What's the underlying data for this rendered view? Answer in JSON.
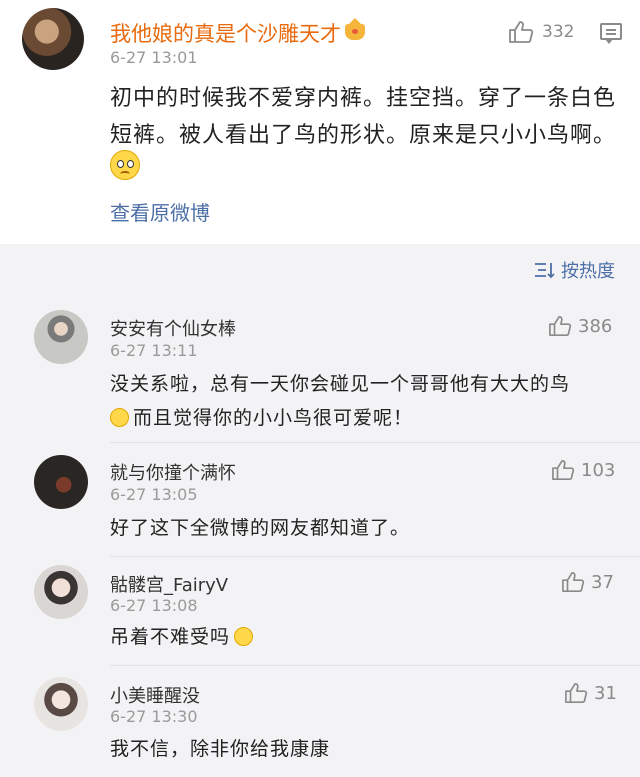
{
  "post": {
    "username": "我他娘的真是个沙雕天才",
    "time": "6-27 13:01",
    "likes": "332",
    "text": "初中的时候我不爱穿内裤。挂空挡。穿了一条白色短裤。被人看出了鸟的形状。原来是只小小鸟啊。",
    "view_original": "查看原微博"
  },
  "sort_label": "按热度",
  "comments": [
    {
      "username": "安安有个仙女棒",
      "time": "6-27 13:11",
      "likes": "386",
      "text_line1": "没关系啦，总有一天你会碰见一个哥哥他有大大的鸟",
      "text_line2": "而且觉得你的小小鸟很可爱呢！"
    },
    {
      "username": "就与你撞个满怀",
      "time": "6-27 13:05",
      "likes": "103",
      "text": "好了这下全微博的网友都知道了。"
    },
    {
      "username": "骷髅宫_FairyV",
      "time": "6-27 13:08",
      "likes": "37",
      "text": "吊着不难受吗"
    },
    {
      "username": "小美睡醒没",
      "time": "6-27 13:30",
      "likes": "31",
      "text": "我不信，除非你给我康康"
    }
  ],
  "colors": {
    "username_vip": "#e86b0f",
    "link": "#4d6fa8",
    "meta": "#9a9a9a"
  },
  "icons": [
    "thumbs-up-icon",
    "comment-icon",
    "sort-icon",
    "crown-icon",
    "emoji-icon"
  ]
}
